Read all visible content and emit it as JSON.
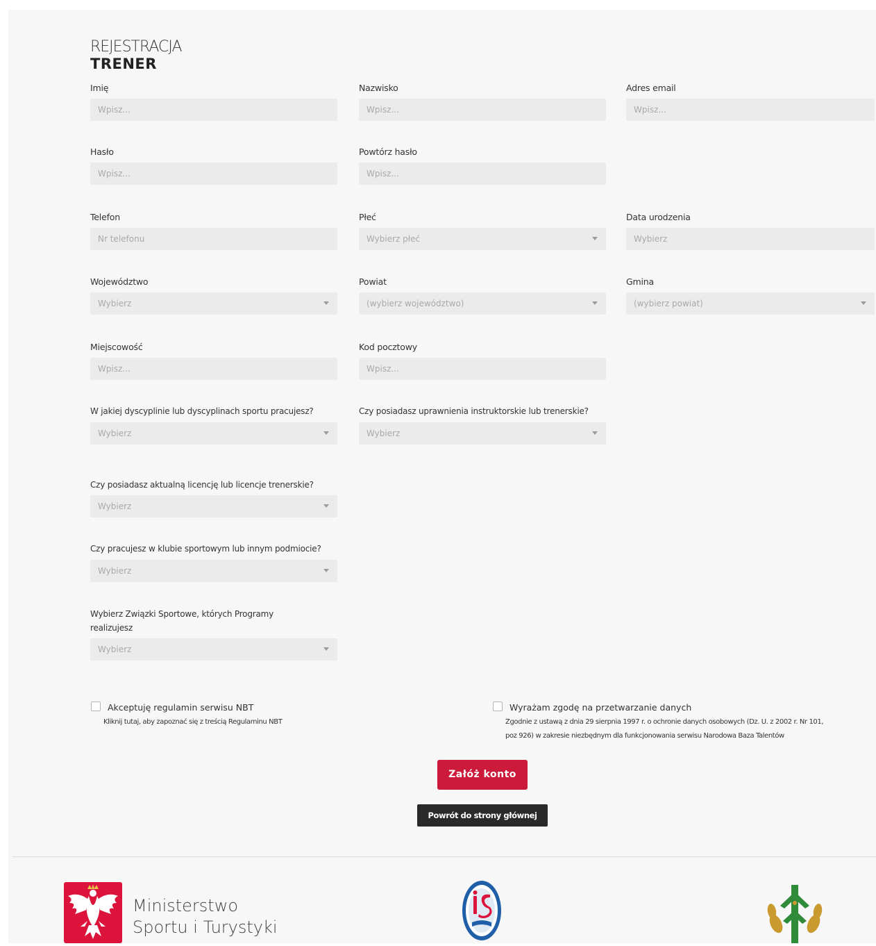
{
  "header": {
    "title_line1": "REJESTRACJA",
    "title_line2": "TRENER"
  },
  "form": {
    "first_name": {
      "label": "Imię",
      "placeholder": "Wpisz..."
    },
    "last_name": {
      "label": "Nazwisko",
      "placeholder": "Wpisz..."
    },
    "email": {
      "label": "Adres email",
      "placeholder": "Wpisz..."
    },
    "password": {
      "label": "Hasło",
      "placeholder": "Wpisz..."
    },
    "password_repeat": {
      "label": "Powtórz hasło",
      "placeholder": "Wpisz..."
    },
    "phone": {
      "label": "Telefon",
      "placeholder": "Nr telefonu"
    },
    "gender": {
      "label": "Płeć",
      "value": "Wybierz płeć"
    },
    "birth_date": {
      "label": "Data urodzenia",
      "placeholder": "Wybierz"
    },
    "voivodeship": {
      "label": "Województwo",
      "value": "Wybierz"
    },
    "county": {
      "label": "Powiat",
      "value": "(wybierz województwo)"
    },
    "commune": {
      "label": "Gmina",
      "value": "(wybierz powiat)"
    },
    "city": {
      "label": "Miejscowość",
      "placeholder": "Wpisz..."
    },
    "postal_code": {
      "label": "Kod pocztowy",
      "placeholder": "Wpisz..."
    },
    "discipline": {
      "label": "W jakiej dyscyplinie lub dyscyplinach sportu pracujesz?",
      "value": "Wybierz"
    },
    "qualifications": {
      "label": "Czy posiadasz uprawnienia instruktorskie lub trenerskie?",
      "value": "Wybierz"
    },
    "license": {
      "label": "Czy posiadasz aktualną licencję lub licencje trenerskie?",
      "value": "Wybierz"
    },
    "club": {
      "label": "Czy pracujesz w klubie sportowym lub innym podmiocie?",
      "value": "Wybierz"
    },
    "unions": {
      "label": "Wybierz Związki Sportowe, których Programy realizujesz",
      "value": "Wybierz"
    }
  },
  "consents": {
    "terms": {
      "label": "Akceptuję regulamin serwisu NBT",
      "sub": "Kliknij tutaj, aby zapoznać się z treścią Regulaminu NBT"
    },
    "data": {
      "label": "Wyrażam zgodę na przetwarzanie danych",
      "sub_line1": "Zgodnie z ustawą z dnia 29 sierpnia 1997 r. o ochronie danych osobowych (Dz. U. z 2002 r. Nr 101,",
      "sub_line2": "poz 926) w zakresie niezbędnym dla funkcjonowania serwisu Narodowa Baza Talentów"
    }
  },
  "actions": {
    "submit_label": "Załóż konto",
    "back_label": "Powrót do strony głównej"
  },
  "footer": {
    "ministry_line1": "Ministerstwo",
    "ministry_line2": "Sportu i Turystyki",
    "colors": {
      "red": "#dc143c",
      "blue": "#1f5fa8",
      "green": "#2f8a3a",
      "gold": "#c99a2e"
    }
  }
}
